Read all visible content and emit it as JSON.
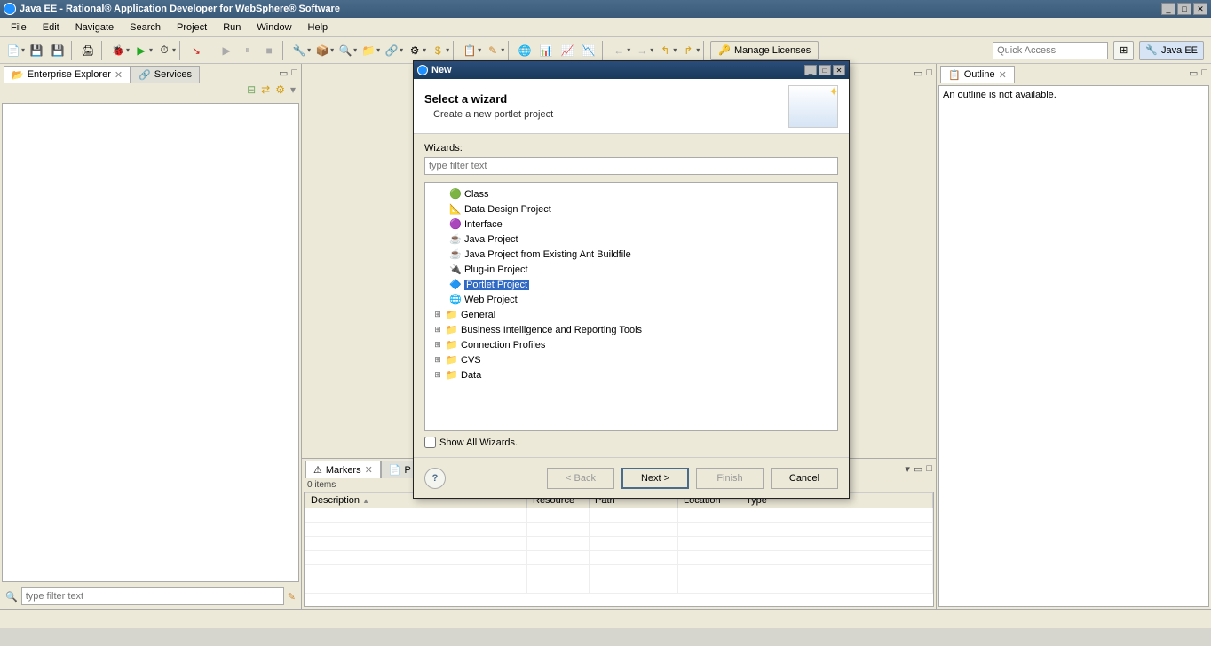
{
  "titlebar": {
    "title": "Java EE - Rational® Application Developer for WebSphere® Software"
  },
  "menu": {
    "file": "File",
    "edit": "Edit",
    "navigate": "Navigate",
    "search": "Search",
    "project": "Project",
    "run": "Run",
    "window": "Window",
    "help": "Help"
  },
  "toolbar": {
    "license": "Manage Licenses",
    "quick_access_placeholder": "Quick Access",
    "perspective": "Java EE"
  },
  "left_panel": {
    "tab_explorer": "Enterprise Explorer",
    "tab_services": "Services",
    "filter_placeholder": "type filter text"
  },
  "right_panel": {
    "tab_outline": "Outline",
    "empty_msg": "An outline is not available."
  },
  "bottom_panel": {
    "tab_markers": "Markers",
    "tab_p": "P",
    "items": "0 items",
    "cols": {
      "description": "Description",
      "resource": "Resource",
      "path": "Path",
      "location": "Location",
      "type": "Type"
    }
  },
  "dialog": {
    "title": "New",
    "heading": "Select a wizard",
    "subheading": "Create a new portlet project",
    "wizards_label": "Wizards:",
    "filter_placeholder": "type filter text",
    "tree": [
      {
        "label": "Class",
        "icon": "class",
        "expandable": false
      },
      {
        "label": "Data Design Project",
        "icon": "design",
        "expandable": false
      },
      {
        "label": "Interface",
        "icon": "iface",
        "expandable": false
      },
      {
        "label": "Java Project",
        "icon": "java",
        "expandable": false
      },
      {
        "label": "Java Project from Existing Ant Buildfile",
        "icon": "java",
        "expandable": false
      },
      {
        "label": "Plug-in Project",
        "icon": "plugin",
        "expandable": false
      },
      {
        "label": "Portlet Project",
        "icon": "portlet",
        "expandable": false,
        "selected": true
      },
      {
        "label": "Web Project",
        "icon": "web",
        "expandable": false
      },
      {
        "label": "General",
        "icon": "folder",
        "expandable": true
      },
      {
        "label": "Business Intelligence and Reporting Tools",
        "icon": "folder",
        "expandable": true
      },
      {
        "label": "Connection Profiles",
        "icon": "folder",
        "expandable": true
      },
      {
        "label": "CVS",
        "icon": "folder",
        "expandable": true
      },
      {
        "label": "Data",
        "icon": "folder",
        "expandable": true
      }
    ],
    "show_all": "Show All Wizards.",
    "buttons": {
      "back": "< Back",
      "next": "Next >",
      "finish": "Finish",
      "cancel": "Cancel"
    }
  }
}
